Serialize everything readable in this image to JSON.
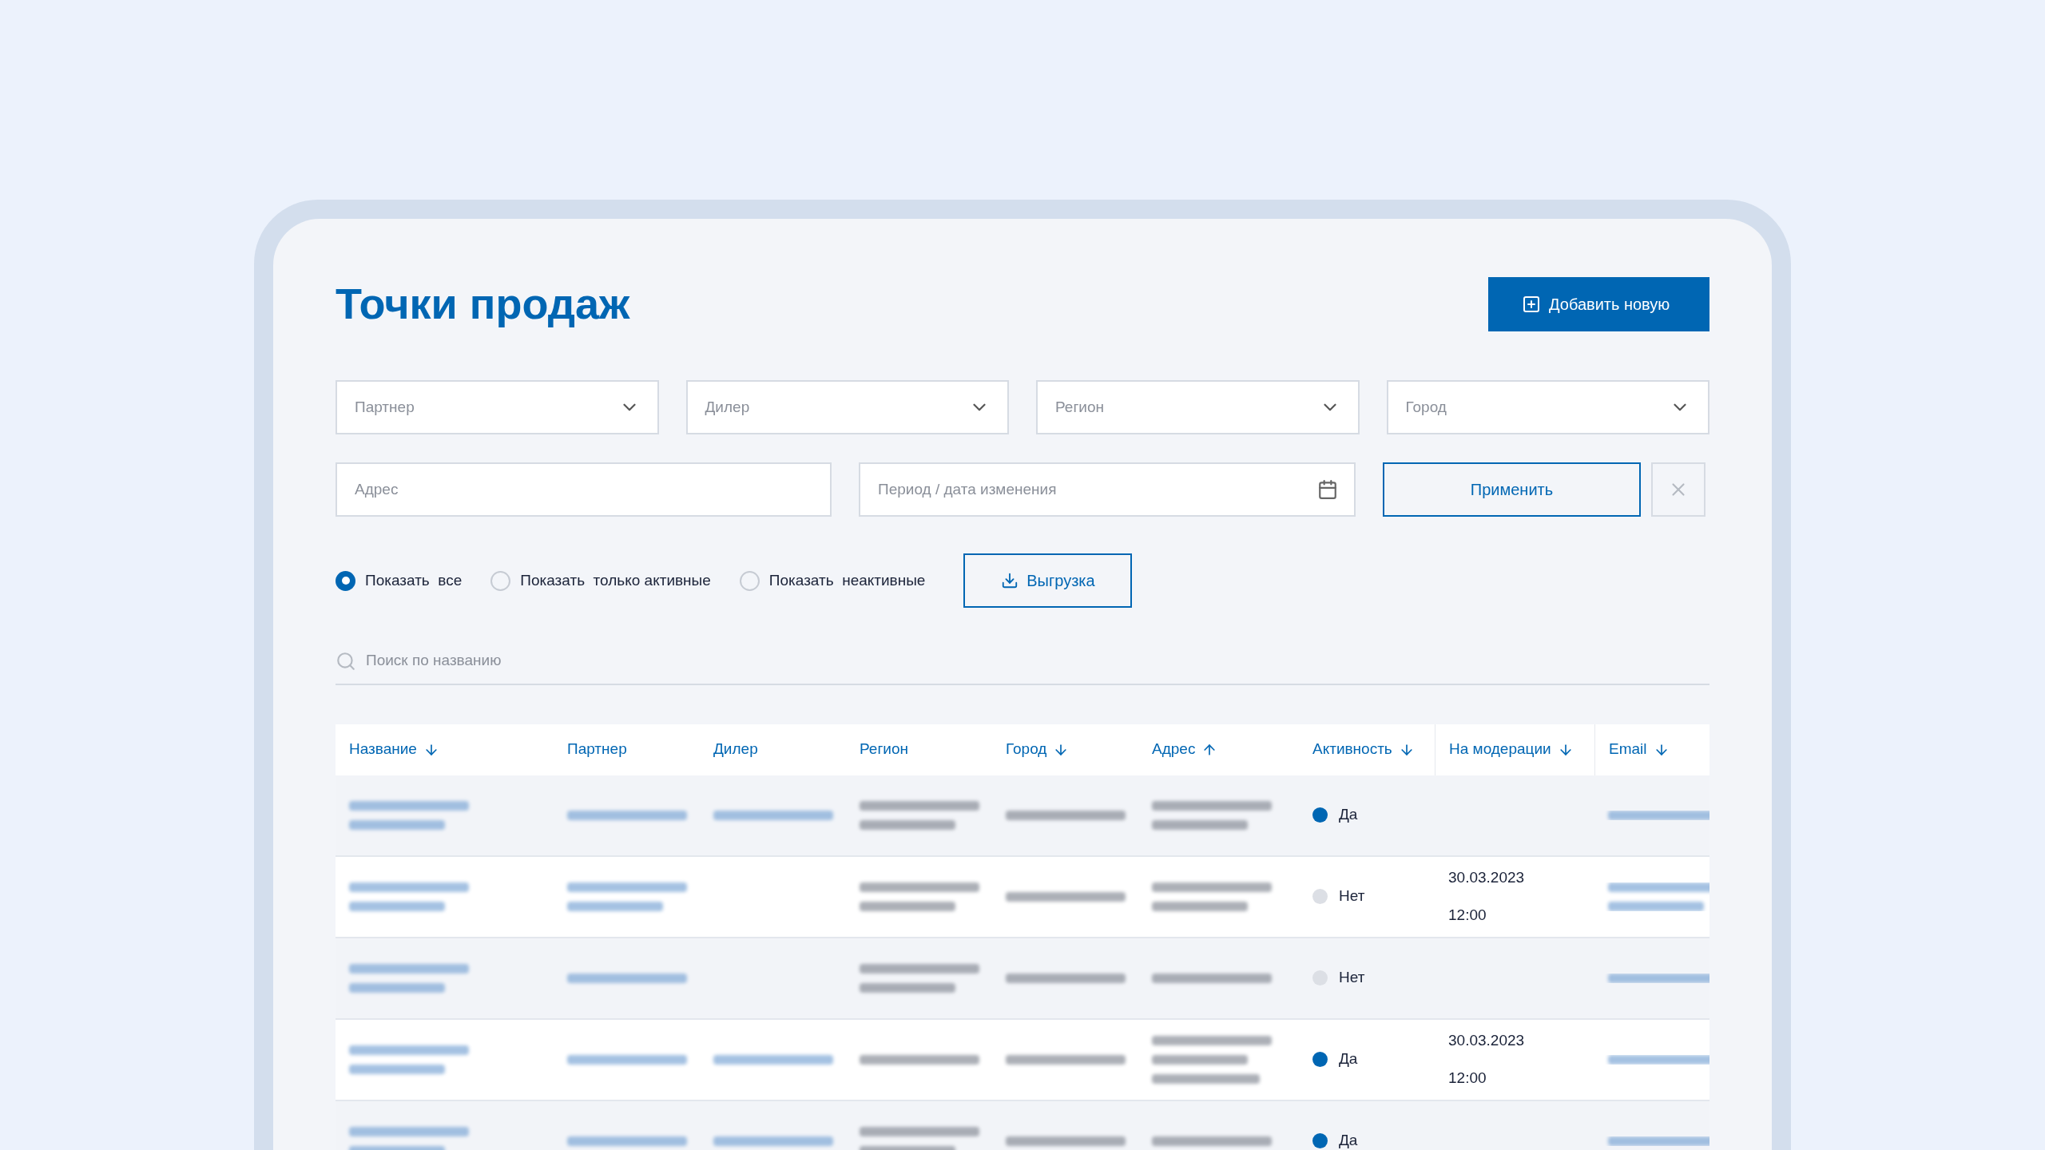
{
  "title": "Точки продаж",
  "add_button": "Добавить новую",
  "filters": [
    {
      "placeholder": "Партнер"
    },
    {
      "placeholder": "Дилер"
    },
    {
      "placeholder": "Регион"
    },
    {
      "placeholder": "Город"
    }
  ],
  "address_field": {
    "placeholder": "Адрес"
  },
  "period_field": {
    "placeholder": "Период / дата изменения"
  },
  "apply_button": "Применить",
  "radios": [
    {
      "label": "Показать  все",
      "selected": true
    },
    {
      "label": "Показать  только активные",
      "selected": false
    },
    {
      "label": "Показать  неактивные",
      "selected": false
    }
  ],
  "export_button": "Выгрузка",
  "search": {
    "placeholder": "Поиск по названию"
  },
  "table": {
    "columns": [
      {
        "label": "Название",
        "sorted": true,
        "ascending": false
      },
      {
        "label": "Партнер",
        "sorted": false
      },
      {
        "label": "Дилер",
        "sorted": false
      },
      {
        "label": "Регион",
        "sorted": false
      },
      {
        "label": "Город",
        "sorted": true,
        "ascending": false
      },
      {
        "label": "Адрес",
        "sorted": true,
        "ascending": true
      },
      {
        "label": "Активность",
        "sorted": true,
        "ascending": false
      },
      {
        "label": "На модерации",
        "sorted": true,
        "ascending": false
      },
      {
        "label": "Email",
        "sorted": true,
        "ascending": false
      }
    ],
    "rows": [
      {
        "cells": [
          {
            "kind": "two_lines",
            "link": true
          },
          {
            "kind": "one_line",
            "link": true
          },
          {
            "kind": "one_line",
            "link": true
          },
          {
            "kind": "two_lines",
            "link": false
          },
          {
            "kind": "one_line",
            "link": false
          },
          {
            "kind": "two_lines",
            "link": false
          }
        ],
        "active": true,
        "activity": "Да",
        "email": {
          "kind": "one_line",
          "link": true
        }
      },
      {
        "cells": [
          {
            "kind": "two_lines",
            "link": true
          },
          {
            "kind": "two_lines",
            "link": true
          },
          {
            "kind": "empty"
          },
          {
            "kind": "two_lines",
            "link": false
          },
          {
            "kind": "one_line",
            "link": false
          },
          {
            "kind": "two_lines",
            "link": false
          }
        ],
        "active": false,
        "activity": "Нет",
        "moderation": [
          "30.03.2023",
          "12:00"
        ],
        "email": {
          "kind": "two_lines",
          "link": true
        }
      },
      {
        "cells": [
          {
            "kind": "two_lines",
            "link": true
          },
          {
            "kind": "one_line",
            "link": true
          },
          {
            "kind": "empty"
          },
          {
            "kind": "two_lines",
            "link": false
          },
          {
            "kind": "one_line",
            "link": false
          },
          {
            "kind": "one_line",
            "link": false
          }
        ],
        "active": false,
        "activity": "Нет",
        "email": {
          "kind": "one_line",
          "link": true
        }
      },
      {
        "cells": [
          {
            "kind": "two_lines",
            "link": true
          },
          {
            "kind": "one_line",
            "link": true
          },
          {
            "kind": "one_line",
            "link": true
          },
          {
            "kind": "one_line",
            "link": false
          },
          {
            "kind": "one_line",
            "link": false
          },
          {
            "kind": "three_lines",
            "link": false
          }
        ],
        "active": true,
        "activity": "Да",
        "moderation": [
          "30.03.2023",
          "12:00"
        ],
        "email": {
          "kind": "one_line",
          "link": true
        }
      },
      {
        "cells": [
          {
            "kind": "two_lines",
            "link": true
          },
          {
            "kind": "one_line",
            "link": true
          },
          {
            "kind": "one_line",
            "link": true
          },
          {
            "kind": "two_lines",
            "link": false
          },
          {
            "kind": "one_line",
            "link": false
          },
          {
            "kind": "one_line",
            "link": false
          }
        ],
        "active": true,
        "activity": "Да",
        "email": {
          "kind": "one_line",
          "link": true
        }
      }
    ]
  }
}
